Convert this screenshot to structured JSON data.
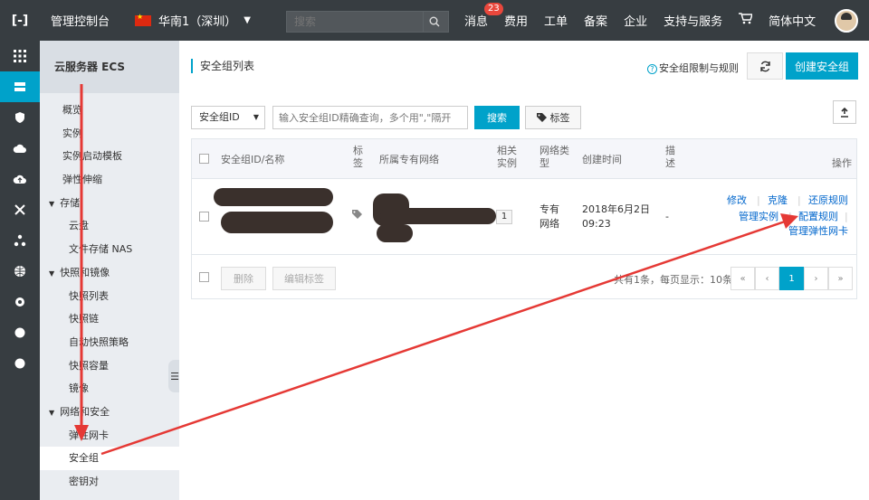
{
  "topbar": {
    "logo": "[-]",
    "console_title": "管理控制台",
    "region": "华南1（深圳）",
    "search_placeholder": "搜索",
    "nav": [
      {
        "label": "消息",
        "badge": "23"
      },
      {
        "label": "费用"
      },
      {
        "label": "工单"
      },
      {
        "label": "备案"
      },
      {
        "label": "企业"
      },
      {
        "label": "支持与服务"
      }
    ],
    "language": "简体中文"
  },
  "sidemenu": {
    "title": "云服务器 ECS",
    "items": [
      {
        "label": "概览",
        "type": "item"
      },
      {
        "label": "实例",
        "type": "item"
      },
      {
        "label": "实例启动模板",
        "type": "item"
      },
      {
        "label": "弹性伸缩",
        "type": "item"
      },
      {
        "label": "存储",
        "type": "group"
      },
      {
        "label": "云盘",
        "type": "sub"
      },
      {
        "label": "文件存储 NAS",
        "type": "sub"
      },
      {
        "label": "快照和镜像",
        "type": "group"
      },
      {
        "label": "快照列表",
        "type": "sub"
      },
      {
        "label": "快照链",
        "type": "sub"
      },
      {
        "label": "自动快照策略",
        "type": "sub"
      },
      {
        "label": "快照容量",
        "type": "sub"
      },
      {
        "label": "镜像",
        "type": "sub"
      },
      {
        "label": "网络和安全",
        "type": "group"
      },
      {
        "label": "弹性网卡",
        "type": "sub"
      },
      {
        "label": "安全组",
        "type": "sub",
        "active": true
      },
      {
        "label": "密钥对",
        "type": "sub"
      }
    ]
  },
  "page": {
    "title": "安全组列表",
    "help_link": "安全组限制与规则",
    "refresh_icon": "refresh-icon",
    "create_button": "创建安全组"
  },
  "filter": {
    "select_value": "安全组ID",
    "input_placeholder": "输入安全组ID精确查询，多个用\",\"隔开",
    "search_button": "搜索",
    "tag_button": "标签"
  },
  "table": {
    "headers": {
      "id_name": "安全组ID/名称",
      "tag": "标签",
      "vpc": "所属专有网络",
      "instances": "相关实例",
      "network_type": "网络类型",
      "created": "创建时间",
      "desc": "描述",
      "actions": "操作"
    },
    "rows": [
      {
        "instances": "1",
        "network_type": "专有网络",
        "created_date": "2018年6月2日",
        "created_time": "09:23",
        "desc": "-",
        "actions": [
          "修改",
          "克隆",
          "还原规则",
          "管理实例",
          "配置规则",
          "管理弹性网卡"
        ]
      }
    ],
    "footer": {
      "delete_button": "删除",
      "edit_tag_button": "编辑标签",
      "pager_info": "共有1条，每页显示：10条",
      "pages": [
        "«",
        "‹",
        "1",
        "›",
        "»"
      ]
    }
  },
  "colors": {
    "accent": "#00a2ca",
    "topbar": "#373d41",
    "annotation": "#e53935"
  }
}
